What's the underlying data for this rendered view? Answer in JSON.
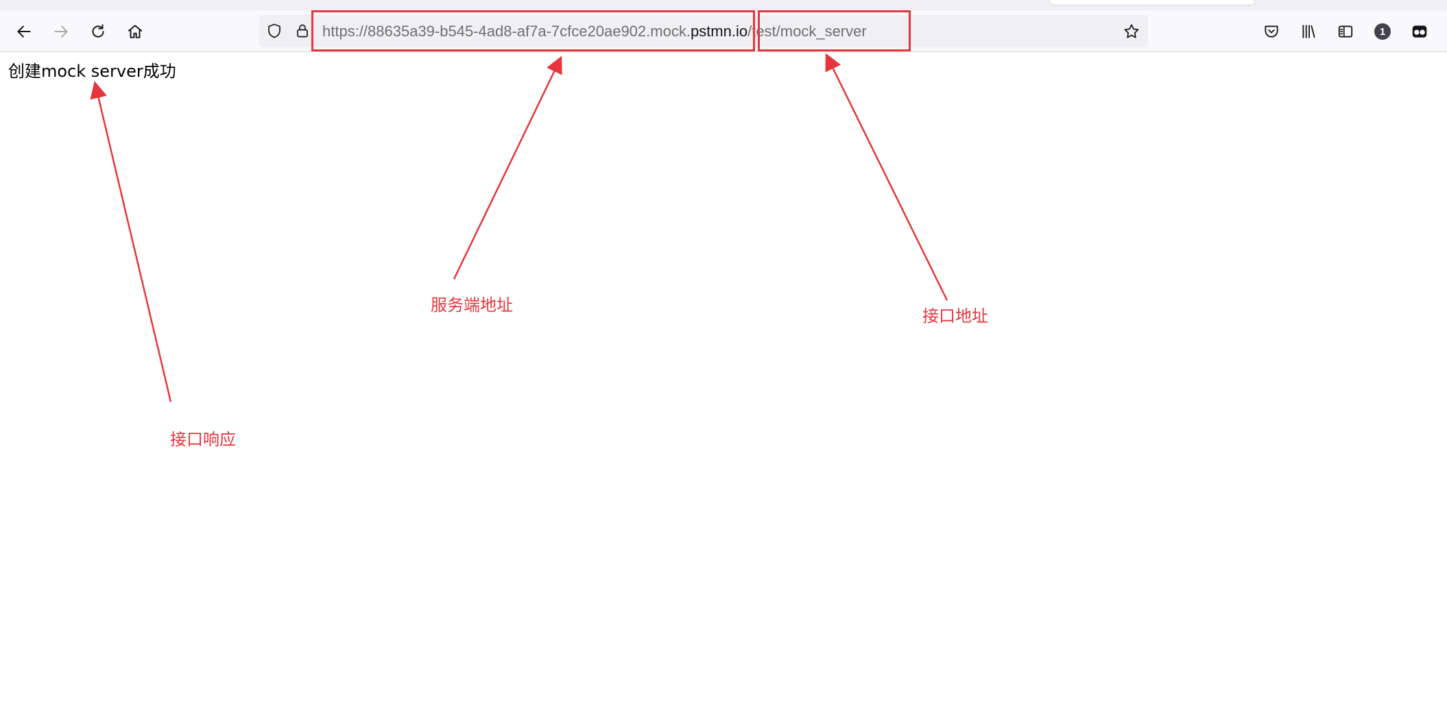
{
  "browser": {
    "url": {
      "scheme_prefix": "https://88635a39-b545-4ad8-af7a-7cfce20ae902.mock.",
      "domain": "pstmn.io",
      "path": "/test/mock_server"
    },
    "badge_count": "1",
    "icons": {
      "back": "back-arrow-icon",
      "forward": "forward-arrow-icon",
      "reload": "reload-icon",
      "home": "home-icon",
      "tracking_protection": "shield-icon",
      "connection": "lock-icon",
      "bookmark": "star-icon",
      "pocket": "pocket-icon",
      "library": "library-icon",
      "sidebar": "sidebar-icon",
      "account": "account-badge-icon",
      "extension": "extension-icon"
    }
  },
  "page": {
    "response_text": "创建mock server成功"
  },
  "annotations": {
    "color": "#e8343c",
    "server_address_label": "服务端地址",
    "endpoint_address_label": "接口地址",
    "endpoint_response_label": "接口响应"
  }
}
